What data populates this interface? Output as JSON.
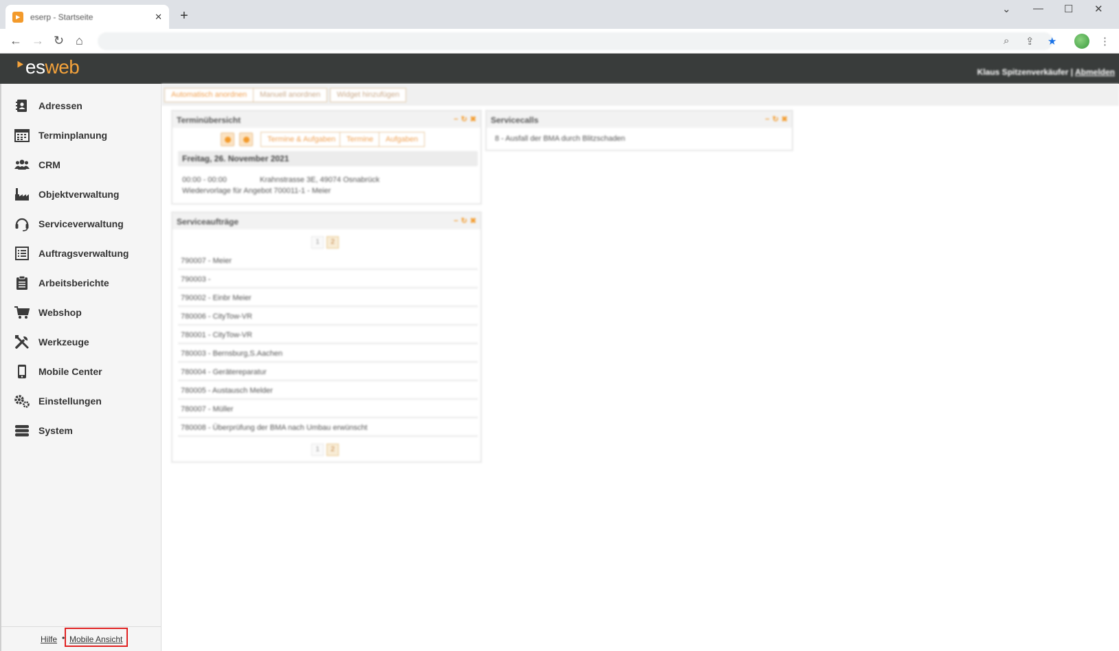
{
  "browser": {
    "tab_title": "eserp - Startseite",
    "tab_favicon": "esweb-favicon",
    "close_icon": "close-icon",
    "new_tab_icon": "plus-icon"
  },
  "app": {
    "logo_prefix": "es",
    "logo_suffix": "web",
    "user_name": "Klaus Spitzenverkäufer",
    "separator": "|",
    "logout_label": "Abmelden",
    "accent_color": "#f39a2b",
    "header_bg": "#393c3b"
  },
  "sidebar": {
    "items": [
      {
        "label": "Adressen",
        "icon": "address-book-icon"
      },
      {
        "label": "Terminplanung",
        "icon": "calendar-icon"
      },
      {
        "label": "CRM",
        "icon": "users-icon"
      },
      {
        "label": "Objektverwaltung",
        "icon": "factory-icon"
      },
      {
        "label": "Serviceverwaltung",
        "icon": "headset-icon"
      },
      {
        "label": "Auftragsverwaltung",
        "icon": "list-icon"
      },
      {
        "label": "Arbeitsberichte",
        "icon": "clipboard-icon"
      },
      {
        "label": "Webshop",
        "icon": "cart-icon"
      },
      {
        "label": "Werkzeuge",
        "icon": "tools-icon"
      },
      {
        "label": "Mobile Center",
        "icon": "mobile-icon"
      },
      {
        "label": "Einstellungen",
        "icon": "gears-icon"
      },
      {
        "label": "System",
        "icon": "database-icon"
      }
    ],
    "footer": {
      "help_label": "Hilfe",
      "dot": "•",
      "mobile_label": "Mobile Ansicht"
    }
  },
  "toolbar": {
    "auto_arrange": "Automatisch anordnen",
    "manual_arrange": "Manuell anordnen",
    "add_widget": "Widget hinzufügen"
  },
  "widgets": {
    "termin": {
      "title": "Terminübersicht",
      "segments": [
        "Termine & Aufgaben",
        "Termine",
        "Aufgaben"
      ],
      "date": "Freitag, 26. November 2021",
      "appointment_time": "00:00 - 00:00",
      "appointment_location": "Krahnstrasse 3E, 49074 Osnabrück",
      "appointment_text": "Wiedervorlage für Angebot 700011-1 - Meier"
    },
    "serviceauftraege": {
      "title": "Serviceaufträge",
      "pages": [
        "1",
        "2"
      ],
      "rows": [
        "790007 - Meier",
        "790003 -",
        "790002 - Einbr Meier",
        "780006 - CityTow-VR",
        "780001 - CityTow-VR",
        "780003 - Bernsburg,S.Aachen",
        "780004 - Gerätereparatur",
        "780005 - Austausch Melder",
        "780007 - Müller",
        "780008 - Überprüfung der BMA nach Umbau erwünscht"
      ]
    },
    "servicecalls": {
      "title": "Servicecalls",
      "rows": [
        "8 - Ausfall der BMA durch Blitzschaden"
      ]
    },
    "controls": {
      "minimize": "−",
      "refresh": "↻",
      "close": "✖"
    }
  }
}
